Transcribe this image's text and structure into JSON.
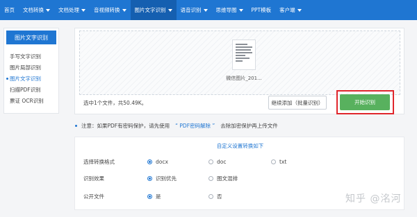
{
  "nav": {
    "items": [
      {
        "label": "首页",
        "caret": false,
        "active": false
      },
      {
        "label": "文档转换",
        "caret": true,
        "active": false
      },
      {
        "label": "文档处理",
        "caret": true,
        "active": false
      },
      {
        "label": "音视频转换",
        "caret": true,
        "active": false
      },
      {
        "label": "图片文字识别",
        "caret": true,
        "active": true
      },
      {
        "label": "语音识别",
        "caret": true,
        "active": false
      },
      {
        "label": "思维导图",
        "caret": true,
        "active": false
      },
      {
        "label": "PPT模板",
        "caret": false,
        "active": false
      },
      {
        "label": "客户端",
        "caret": true,
        "active": false
      }
    ]
  },
  "sidebar": {
    "title": "图片文字识别",
    "items": [
      {
        "label": "手写文字识别",
        "active": false
      },
      {
        "label": "图片局部识别",
        "active": false
      },
      {
        "label": "图片文字识别",
        "active": true
      },
      {
        "label": "扫描PDF识别",
        "active": false
      },
      {
        "label": "票证 OCR识别",
        "active": false
      }
    ]
  },
  "upload": {
    "file_name": "微信图片_201...",
    "status": "选中1个文件，共50.49K。",
    "add_button": "继续添加（批量识别）",
    "start_button": "开始识别"
  },
  "notice": {
    "prefix": "注意：如果PDF有密码保护，请先使用",
    "link": "“ PDF密码解除 ”",
    "suffix": "去除加密保护再上传文件"
  },
  "settings": {
    "title": "自定义设置转换如下",
    "rows": [
      {
        "label": "选择转换格式",
        "options": [
          {
            "label": "docx",
            "selected": true
          },
          {
            "label": "doc",
            "selected": false
          },
          {
            "label": "txt",
            "selected": false
          }
        ]
      },
      {
        "label": "识别效果",
        "options": [
          {
            "label": "识别优先",
            "selected": true
          },
          {
            "label": "图文混排",
            "selected": false
          }
        ]
      },
      {
        "label": "公开文件",
        "options": [
          {
            "label": "是",
            "selected": true
          },
          {
            "label": "否",
            "selected": false
          }
        ]
      }
    ]
  },
  "watermark": "知乎 @洺河",
  "colors": {
    "primary": "#1f76d2",
    "start": "#58b15e",
    "highlight": "#e0262c"
  }
}
